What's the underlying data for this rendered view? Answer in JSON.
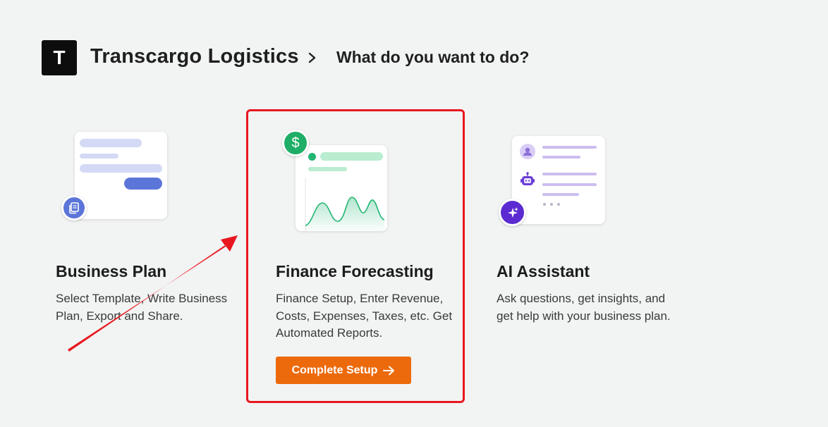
{
  "header": {
    "logo_letter": "T",
    "company": "Transcargo Logistics",
    "breadcrumb_current": "What do you want to do?"
  },
  "options": [
    {
      "title": "Business Plan",
      "description": "Select Template, Write Business Plan, Export and Share.",
      "badge_icon": "document-icon"
    },
    {
      "title": "Finance Forecasting",
      "description": "Finance Setup, Enter Revenue, Costs, Expenses, Taxes, etc. Get Automated Reports.",
      "badge_icon": "dollar-icon",
      "button_label": "Complete Setup"
    },
    {
      "title": "AI Assistant",
      "description": "Ask questions, get insights, and get help with your business plan.",
      "badge_icon": "sparkle-icon"
    }
  ],
  "colors": {
    "primary_button": "#ec6a0c",
    "highlight": "#e8171f",
    "finance_green": "#22b573",
    "business_blue": "#5b75d9",
    "ai_purple": "#5b2bd1"
  }
}
